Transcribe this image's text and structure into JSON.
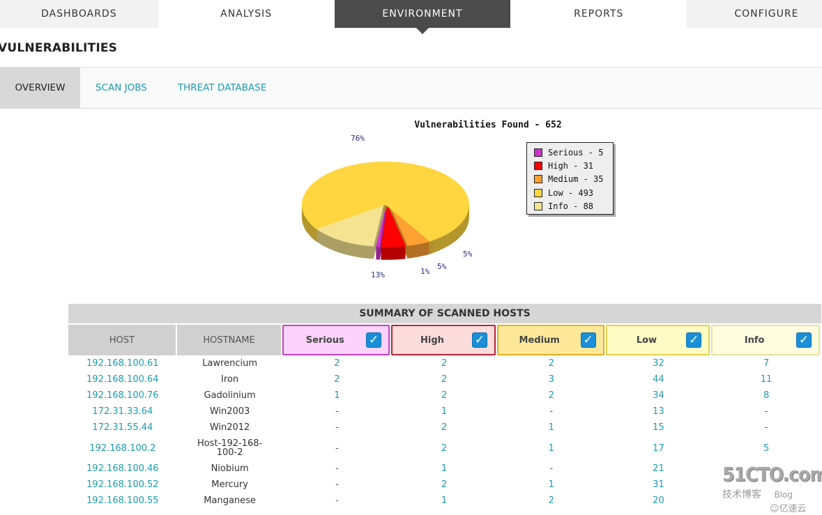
{
  "topnav": {
    "items": [
      {
        "label": "DASHBOARDS"
      },
      {
        "label": "ANALYSIS"
      },
      {
        "label": "ENVIRONMENT",
        "active": true
      },
      {
        "label": "REPORTS"
      },
      {
        "label": "CONFIGURE"
      }
    ]
  },
  "page_title": "VULNERABILITIES",
  "subnav": {
    "items": [
      {
        "label": "OVERVIEW",
        "active": true
      },
      {
        "label": "SCAN JOBS"
      },
      {
        "label": "THREAT DATABASE"
      }
    ]
  },
  "chart_data": {
    "type": "pie",
    "title": "Vulnerabilities Found - 652",
    "categories": [
      "Serious",
      "High",
      "Medium",
      "Low",
      "Info"
    ],
    "values": [
      5,
      31,
      35,
      493,
      88
    ],
    "percent_labels": [
      "1%",
      "5%",
      "5%",
      "76%",
      "13%"
    ],
    "colors": [
      "#cc33cc",
      "#ff0000",
      "#ffa033",
      "#ffd640",
      "#f5e391"
    ],
    "legend": [
      "Serious - 5",
      "High - 31",
      "Medium - 35",
      "Low - 493",
      "Info - 88"
    ],
    "legend_position": "right",
    "style": "3d-exploded"
  },
  "table": {
    "title": "SUMMARY OF SCANNED HOSTS",
    "columns": [
      "HOST",
      "HOSTNAME",
      "Serious",
      "High",
      "Medium",
      "Low",
      "Info"
    ],
    "severity_colors": {
      "Serious": {
        "bg": "#fbd3fb",
        "border": "#c040c0"
      },
      "High": {
        "bg": "#fddcdc",
        "border": "#c02030"
      },
      "Medium": {
        "bg": "#fde89a",
        "border": "#e0b020"
      },
      "Low": {
        "bg": "#fefbc4",
        "border": "#e8d050"
      },
      "Info": {
        "bg": "#fefde0",
        "border": "#e8e0a0"
      }
    },
    "filters_checked": [
      true,
      true,
      true,
      true,
      true
    ],
    "rows": [
      [
        "192.168.100.61",
        "Lawrencium",
        "2",
        "2",
        "2",
        "32",
        "7"
      ],
      [
        "192.168.100.64",
        "Iron",
        "2",
        "2",
        "3",
        "44",
        "11"
      ],
      [
        "192.168.100.76",
        "Gadolinium",
        "1",
        "2",
        "2",
        "34",
        "8"
      ],
      [
        "172.31.33.64",
        "Win2003",
        "-",
        "1",
        "-",
        "13",
        "-"
      ],
      [
        "172.31.55.44",
        "Win2012",
        "-",
        "2",
        "1",
        "15",
        "-"
      ],
      [
        "192.168.100.2",
        "Host-192-168-100-2",
        "-",
        "2",
        "1",
        "17",
        "5"
      ],
      [
        "192.168.100.46",
        "Niobium",
        "-",
        "1",
        "-",
        "21",
        ""
      ],
      [
        "192.168.100.52",
        "Mercury",
        "-",
        "2",
        "1",
        "31",
        ""
      ],
      [
        "192.168.100.55",
        "Manganese",
        "-",
        "1",
        "2",
        "20",
        ""
      ]
    ]
  },
  "watermark": {
    "line1": "51CTO.com",
    "line2": "技术博客",
    "line3": "Blog",
    "line4": "亿速云"
  }
}
